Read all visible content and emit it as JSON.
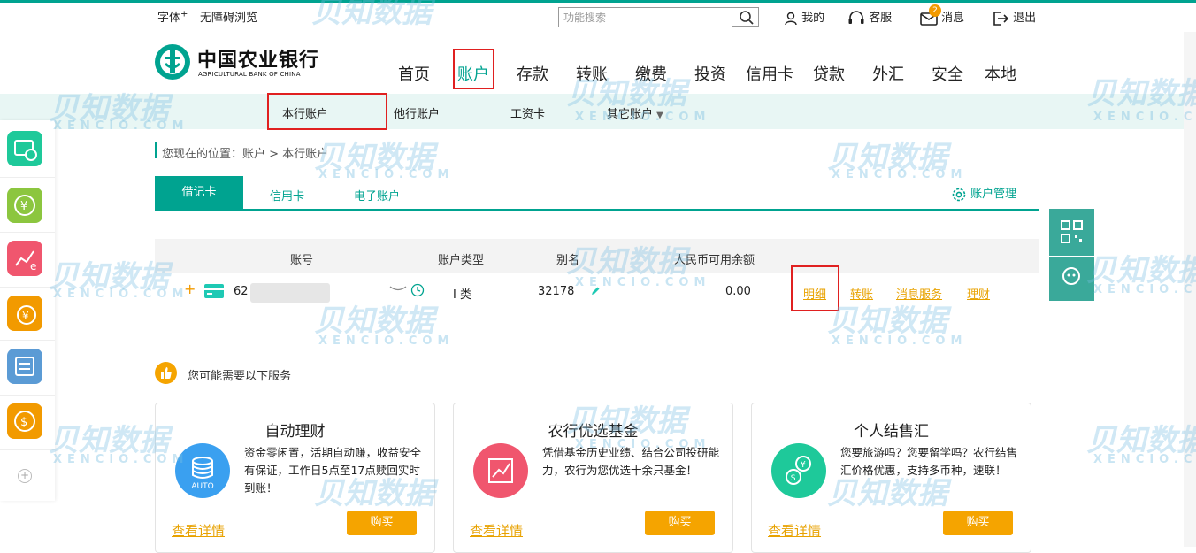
{
  "topbar": {
    "font_label": "字体",
    "font_sup": "+",
    "accessibility": "无障碍浏览",
    "search_placeholder": "功能搜索",
    "mine": "我的",
    "service": "客服",
    "messages": "消息",
    "message_badge": "2",
    "logout": "退出"
  },
  "logo": {
    "cn": "中国农业银行",
    "en": "AGRICULTURAL BANK OF CHINA"
  },
  "nav": [
    "首页",
    "账户",
    "存款",
    "转账",
    "缴费",
    "投资",
    "信用卡",
    "贷款",
    "外汇",
    "安全",
    "本地"
  ],
  "subnav": {
    "own_account": "本行账户",
    "other_account": "他行账户",
    "third": "工资卡",
    "others": "其它账户"
  },
  "breadcrumb": "您现在的位置：账户 > 本行账户",
  "tabs": {
    "debit": "借记卡",
    "credit": "信用卡",
    "electronic": "电子账户",
    "manage": "账户管理"
  },
  "table": {
    "headers": {
      "account_no": "账号",
      "type": "账户类型",
      "alias": "别名",
      "balance": "人民币可用余额"
    },
    "row": {
      "expand": "+",
      "account_prefix": "62",
      "type": "I 类",
      "alias": "32178",
      "balance": "0.00",
      "actions": [
        "明细",
        "转账",
        "消息服务",
        "理财"
      ]
    }
  },
  "services": {
    "title": "您可能需要以下服务",
    "cards": [
      {
        "title": "自动理财",
        "icon_label": "AUTO",
        "desc": "资金零闲置，活期自动赚，收益安全有保证，工作日5点至17点赎回实时到账！",
        "more": "查看详情",
        "buy": "购买",
        "color": "#3aa0f0"
      },
      {
        "title": "农行优选基金",
        "desc": "凭借基金历史业绩、结合公司投研能力，农行为您优选十余只基金！",
        "more": "查看详情",
        "buy": "购买",
        "color": "#f0566e"
      },
      {
        "title": "个人结售汇",
        "desc": "您要旅游吗？您要留学吗？农行结售汇价格优惠，支持多币种，速联！",
        "more": "查看详情",
        "buy": "购买",
        "color": "#1ec99a"
      }
    ]
  },
  "watermark": {
    "cn": "贝知数据",
    "en": "XENCIO.COM"
  },
  "colors": {
    "brand": "#00a390",
    "link": "#e8a200",
    "highlight": "#e02020"
  }
}
